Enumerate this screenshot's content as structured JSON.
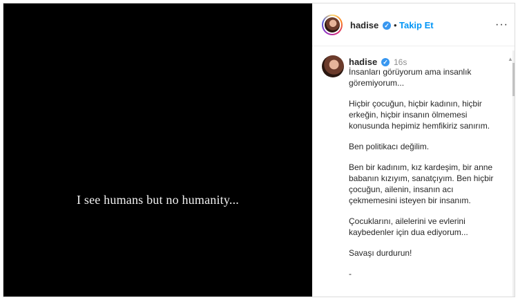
{
  "media": {
    "caption": "I see humans but no humanity..."
  },
  "header": {
    "username": "hadise",
    "separator": "•",
    "follow_label": "Takip Et",
    "more_label": "···"
  },
  "post": {
    "username": "hadise",
    "time": "16s",
    "paragraphs": [
      "İnsanları görüyorum ama insanlık\ngöremiyorum...",
      "Hiçbir çocuğun, hiçbir kadının, hiçbir\nerkeğin, hiçbir insanın ölmemesi\nkonusunda hepimiz hemfikiriz sanırım.",
      "Ben politikacı değilim.",
      "Ben bir kadınım, kız kardeşim, bir anne\nbabanın kızıyım, sanatçıyım. Ben hiçbir\nçocuğun, ailenin, insanın acı\nçekmemesini isteyen bir insanım.",
      "Çocuklarını, ailelerini ve evlerini\nkaybedenler için dua ediyorum...",
      "Savaşı durdurun!",
      "-"
    ]
  },
  "colors": {
    "accent": "#0095f6",
    "verified": "#3897f0",
    "media_background": "#000000"
  },
  "icons": {
    "verified": "verified-badge-icon",
    "more": "more-options-icon",
    "scroll_up": "scroll-up-arrow-icon"
  }
}
